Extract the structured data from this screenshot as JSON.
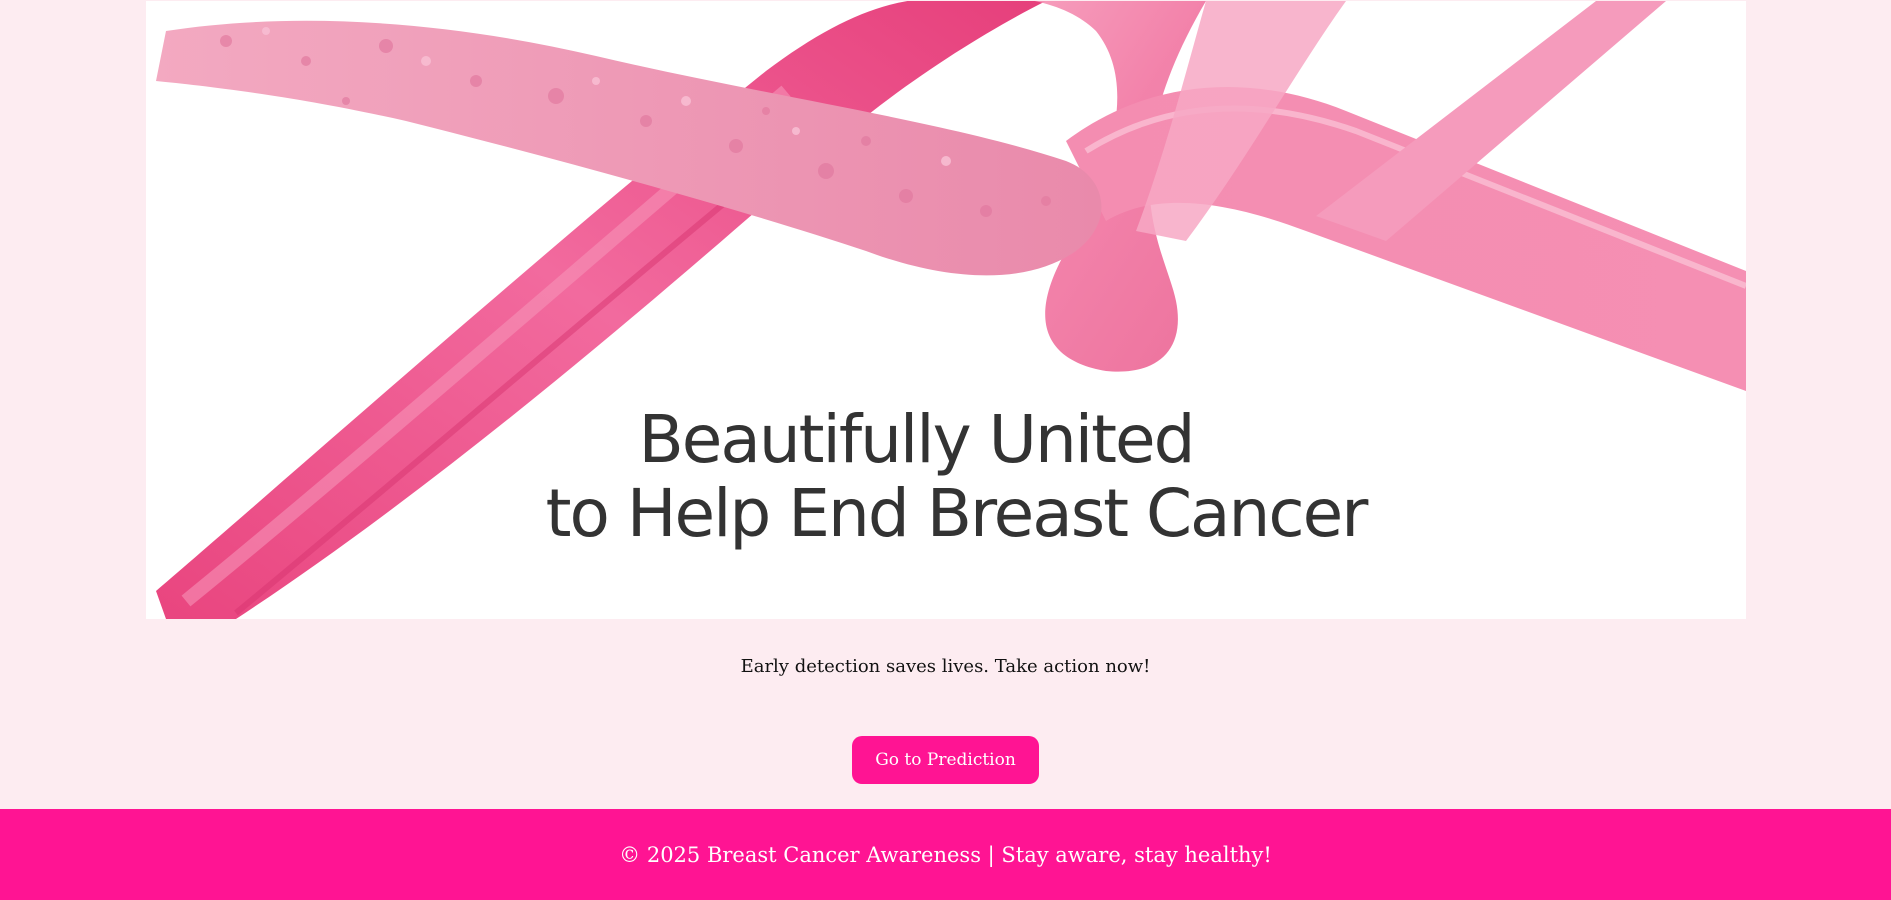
{
  "hero": {
    "image_name": "pink-ribbon-banner",
    "headline_line1": "Beautifully United",
    "headline_line2": "to Help End Breast Cancer"
  },
  "main": {
    "tagline": "Early detection saves lives. Take action now!",
    "cta_label": "Go to Prediction"
  },
  "footer": {
    "text": "© 2025 Breast Cancer Awareness | Stay aware, stay healthy!"
  },
  "colors": {
    "page_background": "#fdecf1",
    "accent": "#ff1493",
    "ribbon": "#f0679b"
  }
}
